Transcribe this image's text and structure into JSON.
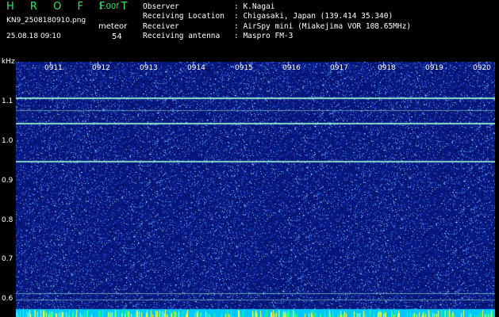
{
  "header": {
    "brand": "H R O F F T",
    "version": "1.00f",
    "filename": "KN9_2508180910.png",
    "meteor_label": "meteor",
    "datetime": "25.08.18 09:10",
    "meteor_count": "54"
  },
  "info": [
    {
      "key": "Observer",
      "value": ": K.Nagai"
    },
    {
      "key": "Receiving Location",
      "value": ": Chigasaki, Japan (139.414 35.340)"
    },
    {
      "key": "Receiver",
      "value": ": AirSpy mini (Miakejima VOR 108.65MHz)"
    },
    {
      "key": "Receiving antenna",
      "value": ": Maspro FM-3"
    }
  ],
  "axis": {
    "unit": "kHz",
    "y_ticks": [
      "1.1",
      "1.0",
      "0.9",
      "0.8",
      "0.7",
      "0.6"
    ],
    "x_ticks": [
      "0911",
      "0912",
      "0913",
      "0914",
      "0915",
      "0916",
      "0917",
      "0918",
      "0919",
      "0920"
    ]
  },
  "colors": {
    "background": "#000000",
    "noise_base": "#0a1a8c",
    "signal": "#8cf0d0",
    "brand": "#2ee86a",
    "footer": "#00c8ff"
  }
}
